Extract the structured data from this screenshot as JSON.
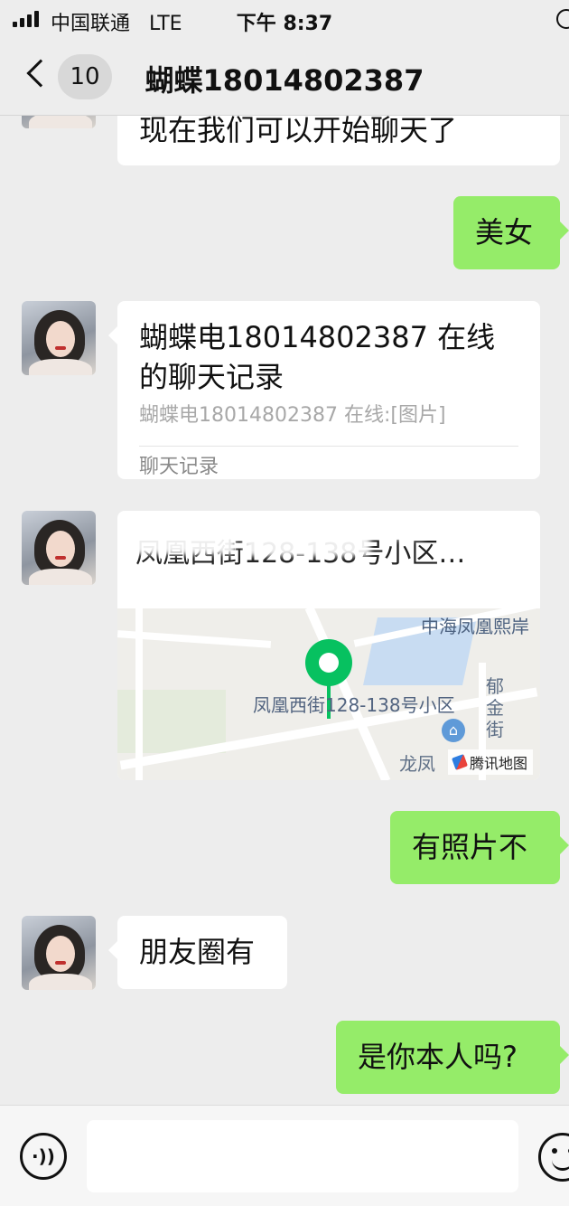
{
  "status_bar": {
    "carrier": "中国联通",
    "network": "LTE",
    "time": "下午 8:37"
  },
  "nav": {
    "unread_count": "10",
    "title": "蝴蝶18014802387"
  },
  "messages": [
    {
      "side": "in",
      "text": "现在我们可以开始聊天了"
    },
    {
      "side": "out",
      "text": "美女"
    },
    {
      "side": "in",
      "type": "chat_record",
      "title": "蝴蝶电18014802387 在线的聊天记录",
      "preview": "蝴蝶电18014802387  在线:[图片]",
      "footer": "聊天记录"
    },
    {
      "side": "in",
      "type": "location",
      "name": "凤凰西街128-138号小区…",
      "address": "",
      "map_center_label": "凤凰西街128-138号小区",
      "map_labels": [
        "中海凤凰熙岸",
        "郁金街",
        "龙凤"
      ],
      "map_brand": "腾讯地图"
    },
    {
      "side": "out",
      "text": "有照片不"
    },
    {
      "side": "in",
      "text": "朋友圈有"
    },
    {
      "side": "out",
      "text": "是你本人吗?"
    }
  ],
  "input": {
    "value": "",
    "voice_icon": "voice-icon",
    "emoji_icon": "emoji-icon"
  },
  "colors": {
    "background": "#ededed",
    "outgoing": "#95ec69",
    "incoming": "#ffffff",
    "pin": "#07c160"
  }
}
